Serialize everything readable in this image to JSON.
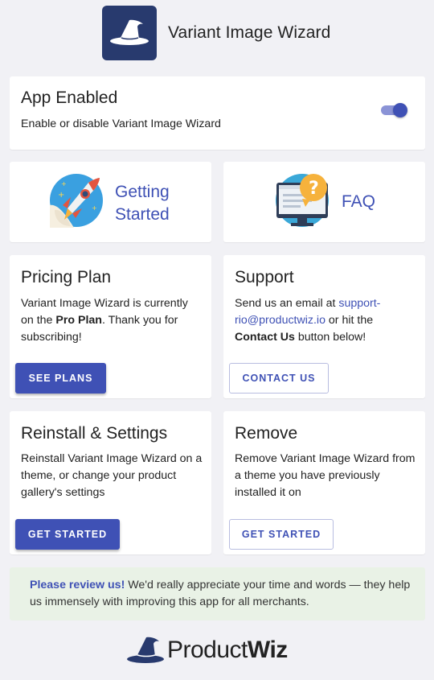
{
  "header": {
    "app_title": "Variant Image Wizard",
    "logo_icon": "wizard-hat-icon"
  },
  "enable_card": {
    "title": "App Enabled",
    "description": "Enable or disable Variant Image Wizard",
    "toggle_on": true
  },
  "nav_cards": [
    {
      "label_line1": "Getting",
      "label_line2": "Started",
      "icon": "rocket-icon"
    },
    {
      "label": "FAQ",
      "icon": "faq-monitor-icon"
    }
  ],
  "pricing": {
    "title": "Pricing Plan",
    "text_before": "Variant Image Wizard is currently on the ",
    "plan": "Pro Plan",
    "text_after": ". Thank you for subscribing!",
    "button": "SEE PLANS"
  },
  "support": {
    "title": "Support",
    "text_before": "Send us an email at ",
    "email": "support-rio@productwiz.io",
    "text_middle": " or hit the ",
    "contact_bold": "Contact Us",
    "text_after": " button below!",
    "button": "CONTACT US"
  },
  "reinstall": {
    "title": "Reinstall & Settings",
    "text": "Reinstall Variant Image Wizard on a theme, or change your product gallery's settings",
    "button": "GET STARTED"
  },
  "remove": {
    "title": "Remove",
    "text": "Remove Variant Image Wizard from a theme you have previously installed it on",
    "button": "GET STARTED"
  },
  "review": {
    "bold": "Please review us!",
    "text": " We'd really appreciate your time and words — they help us immensely with improving this app for all merchants."
  },
  "footer": {
    "brand_part1": "Product",
    "brand_part2": "Wiz"
  },
  "colors": {
    "accent": "#3f51b5",
    "logo_bg": "#283a6e",
    "review_bg": "#e9f2e6",
    "page_bg": "#f1f1f5"
  }
}
